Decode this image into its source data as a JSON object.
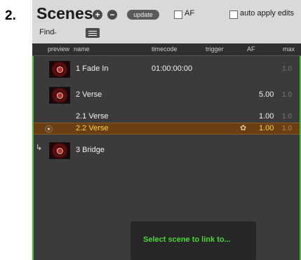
{
  "step_label": "2.",
  "header": {
    "title": "Scenes",
    "add_icon": "plus-circle-icon",
    "remove_icon": "minus-circle-icon",
    "update_label": "update",
    "af_label": "AF",
    "auto_apply_label": "auto apply edits",
    "find_label": "Find",
    "find_arrow": "▸",
    "menu_icon": "hamburger-icon"
  },
  "columns": [
    "preview",
    "name",
    "timecode",
    "trigger",
    "AF",
    "max"
  ],
  "rows": [
    {
      "name": "1 Fade In",
      "timecode": "01:00:00:00",
      "af": "",
      "max": "1.0"
    },
    {
      "name": "2 Verse",
      "timecode": "",
      "af": "5.00",
      "max": "1.0"
    },
    {
      "name": "2.1 Verse",
      "timecode": "",
      "af": "1.00",
      "max": "1.0"
    },
    {
      "name": "2.2 Verse",
      "timecode": "",
      "af": "1.00",
      "max": "1.0"
    },
    {
      "name": "3 Bridge",
      "timecode": "",
      "af": "",
      "max": ""
    }
  ],
  "toast": "Select scene to link to...",
  "colors": {
    "accent": "#4cbf3a",
    "selection": "#6a3f14",
    "selection_text": "#ffd23a"
  }
}
